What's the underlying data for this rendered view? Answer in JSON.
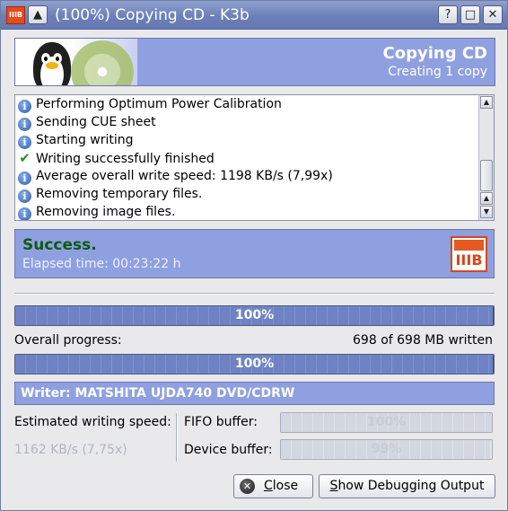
{
  "window": {
    "title": "(100%) Copying CD - K3b",
    "app_icon": "k3b-icon",
    "controls": {
      "shade": "▲",
      "help": "?",
      "maximize": "□",
      "close": "✕"
    }
  },
  "banner": {
    "title": "Copying CD",
    "subtitle": "Creating 1 copy"
  },
  "log": {
    "items": [
      {
        "icon": "info-icon",
        "text": "Performing Optimum Power Calibration"
      },
      {
        "icon": "info-icon",
        "text": "Sending CUE sheet"
      },
      {
        "icon": "info-icon",
        "text": "Starting writing"
      },
      {
        "icon": "check-icon",
        "text": "Writing successfully finished"
      },
      {
        "icon": "info-icon",
        "text": "Average overall write speed: 1198 KB/s (7,99x)"
      },
      {
        "icon": "info-icon",
        "text": "Removing temporary files."
      },
      {
        "icon": "info-icon",
        "text": "Removing image files."
      }
    ]
  },
  "status": {
    "title": "Success.",
    "elapsed": "Elapsed time: 00:23:22 h",
    "logo_text": "IIIB"
  },
  "progress": {
    "track": {
      "value": 1.0,
      "label": "100%"
    },
    "overall": {
      "value": 1.0,
      "label": "100%"
    },
    "overall_label": "Overall progress:",
    "overall_written": "698 of 698 MB written"
  },
  "writer": {
    "label": "Writer: MATSHITA UJDA740 DVD/CDRW"
  },
  "speed": {
    "label": "Estimated writing speed:",
    "value": "1162 KB/s (7,75x)"
  },
  "buffers": {
    "fifo": {
      "label": "FIFO buffer:",
      "value": 1.0,
      "text": "100%"
    },
    "device": {
      "label": "Device buffer:",
      "value": 0.99,
      "text": "99%"
    }
  },
  "buttons": {
    "close": {
      "mnemonic": "C",
      "rest": "lose"
    },
    "debug": {
      "mnemonic": "S",
      "rest": "how Debugging Output"
    }
  },
  "colors": {
    "titlebar": "#6d80b8",
    "panel": "#8fa0e1",
    "progress_fill": "#6f83c4",
    "success_text": "#0e5a11",
    "k3b_orange": "#e35a22"
  }
}
